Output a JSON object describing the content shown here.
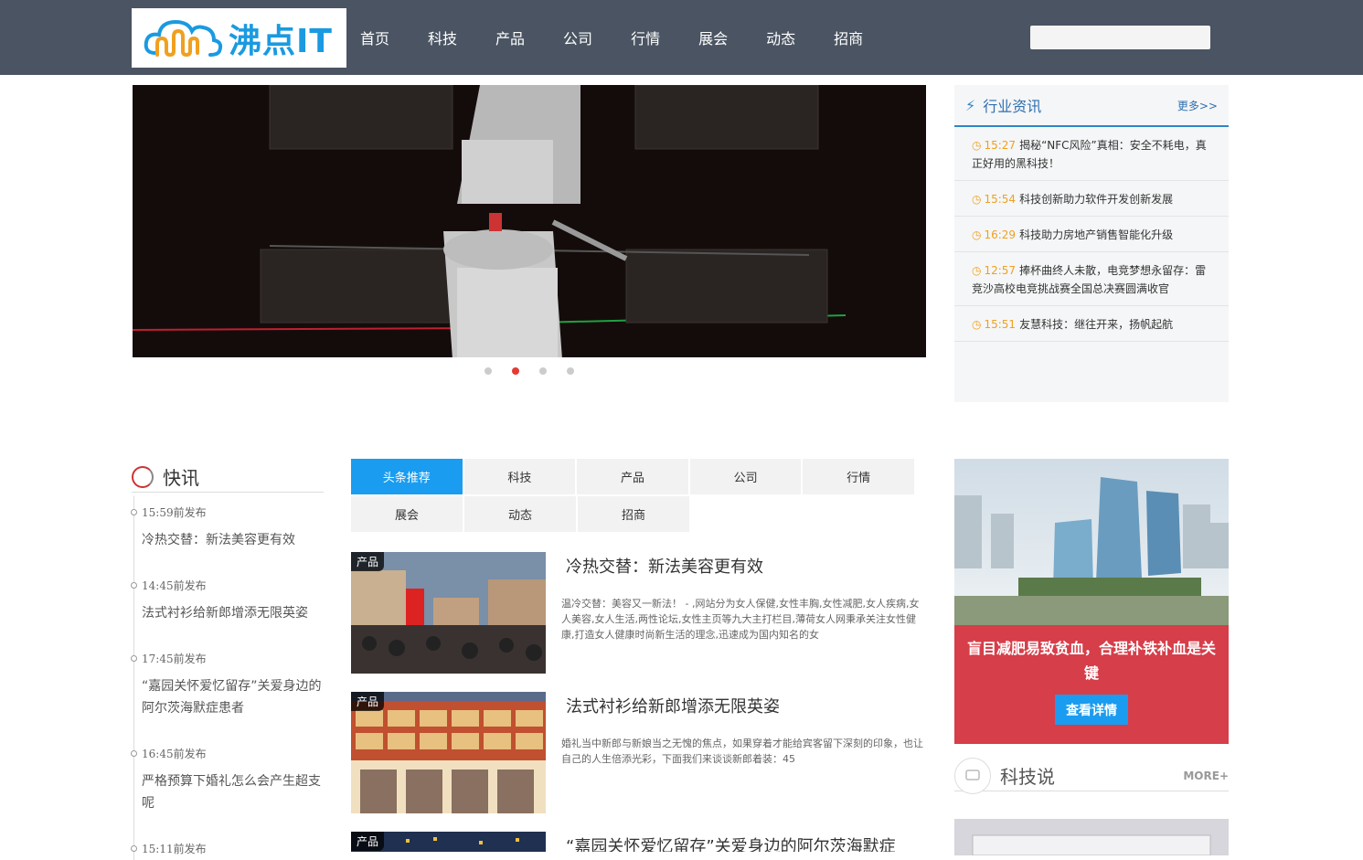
{
  "brand": {
    "name": "沸点IT",
    "logo_icon": "cloud-waveform-logo-icon"
  },
  "nav": [
    "首页",
    "科技",
    "产品",
    "公司",
    "行情",
    "展会",
    "动态",
    "招商"
  ],
  "search": {
    "placeholder": ""
  },
  "banner": {
    "dots_count": 4,
    "active_dot": 2
  },
  "industry_news": {
    "title": "行业资讯",
    "more": "更多>>",
    "items": [
      {
        "time": "15:27",
        "text": "揭秘“NFC风险”真相：安全不耗电，真正好用的黑科技！"
      },
      {
        "time": "15:54",
        "text": "科技创新助力软件开发创新发展"
      },
      {
        "time": "16:29",
        "text": "科技助力房地产销售智能化升级"
      },
      {
        "time": "12:57",
        "text": "捧杯曲终人未散，电竞梦想永留存：雷竞沙高校电竞挑战赛全国总决赛圆满收官"
      },
      {
        "time": "15:51",
        "text": "友慧科技：继往开来，扬帆起航"
      }
    ]
  },
  "flash": {
    "title": "快讯",
    "items": [
      {
        "time": "15:59前发布",
        "text": "冷热交替：新法美容更有效"
      },
      {
        "time": "14:45前发布",
        "text": "法式衬衫给新郎增添无限英姿"
      },
      {
        "time": "17:45前发布",
        "text": "“嘉园关怀爱忆留存”关爱身边的阿尔茨海默症患者"
      },
      {
        "time": "16:45前发布",
        "text": "严格预算下婚礼怎么会产生超支呢"
      },
      {
        "time": "15:11前发布",
        "text": ""
      }
    ]
  },
  "tabs": {
    "row1": [
      "头条推荐",
      "科技",
      "产品",
      "公司",
      "行情"
    ],
    "row2": [
      "展会",
      "动态",
      "招商"
    ],
    "active": "头条推荐"
  },
  "articles": [
    {
      "badge": "产品",
      "title": "冷热交替：新法美容更有效",
      "desc": "温冷交替：美容又一新法！ - ,网站分为女人保健,女性丰胸,女性减肥,女人疾病,女人美容,女人生活,两性论坛,女性主页等九大主打栏目,薄荷女人网秉承关注女性健康,打造女人健康时尚新生活的理念,迅速成为国内知名的女"
    },
    {
      "badge": "产品",
      "title": "法式衬衫给新郎增添无限英姿",
      "desc": "婚礼当中新郎与新娘当之无愧的焦点，如果穿着才能给宾客留下深刻的印象，也让自己的人生倍添光彩，下面我们来谈谈新郎着装：",
      "desc_extra": "45"
    },
    {
      "badge": "产品",
      "title": "“嘉园关怀爱忆留存”关爱身边的阿尔茨海默症",
      "desc": ""
    }
  ],
  "ad": {
    "text": "盲目减肥易致贫血，合理补铁补血是关键",
    "button": "查看详情"
  },
  "tech_talk": {
    "title": "科技说",
    "more": "MORE+"
  },
  "colors": {
    "topbar": "#4a5462",
    "accent": "#1a9cf0",
    "ad_bg": "#d63e4a",
    "time": "#f0a020",
    "dot_active": "#e53935"
  }
}
